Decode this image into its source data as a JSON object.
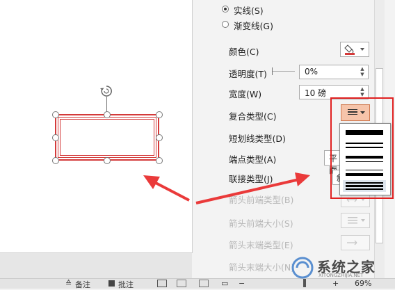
{
  "pane": {
    "line_type": {
      "solid_label": "实线(S)",
      "gradient_label": "渐变线(G)",
      "selected": "solid"
    },
    "rows": {
      "color": "颜色(C)",
      "transparency": "透明度(T)",
      "width": "宽度(W)",
      "compound_type": "复合类型(C)",
      "dash_type": "短划线类型(D)",
      "cap_type": "端点类型(A)",
      "join_type": "联接类型(J)",
      "begin_arrow_type": "箭头前端类型(B)",
      "begin_arrow_size": "箭头前端大小(S)",
      "end_arrow_type": "箭头末端类型(E)",
      "end_arrow_size": "箭头末端大小(N)"
    },
    "values": {
      "transparency": "0%",
      "width": "10 磅",
      "cap_type_partial": "平面",
      "join_type_partial": "斜"
    }
  },
  "colors": {
    "line_color": "#d43a3a",
    "highlight": "#e02020",
    "selected_button_bg": "#f6c4aa",
    "arrow": "#ea3a3a"
  },
  "icons": {
    "rotate": "rotate-handle-icon",
    "pen": "pen-color-icon",
    "compound": "compound-lines-icon"
  },
  "statusbar": {
    "notes_label": "备注",
    "comments_label": "批注",
    "zoom": "69%"
  },
  "watermark": {
    "text": "系统之家",
    "subtext": "XITONGZHIJIA.NET"
  }
}
